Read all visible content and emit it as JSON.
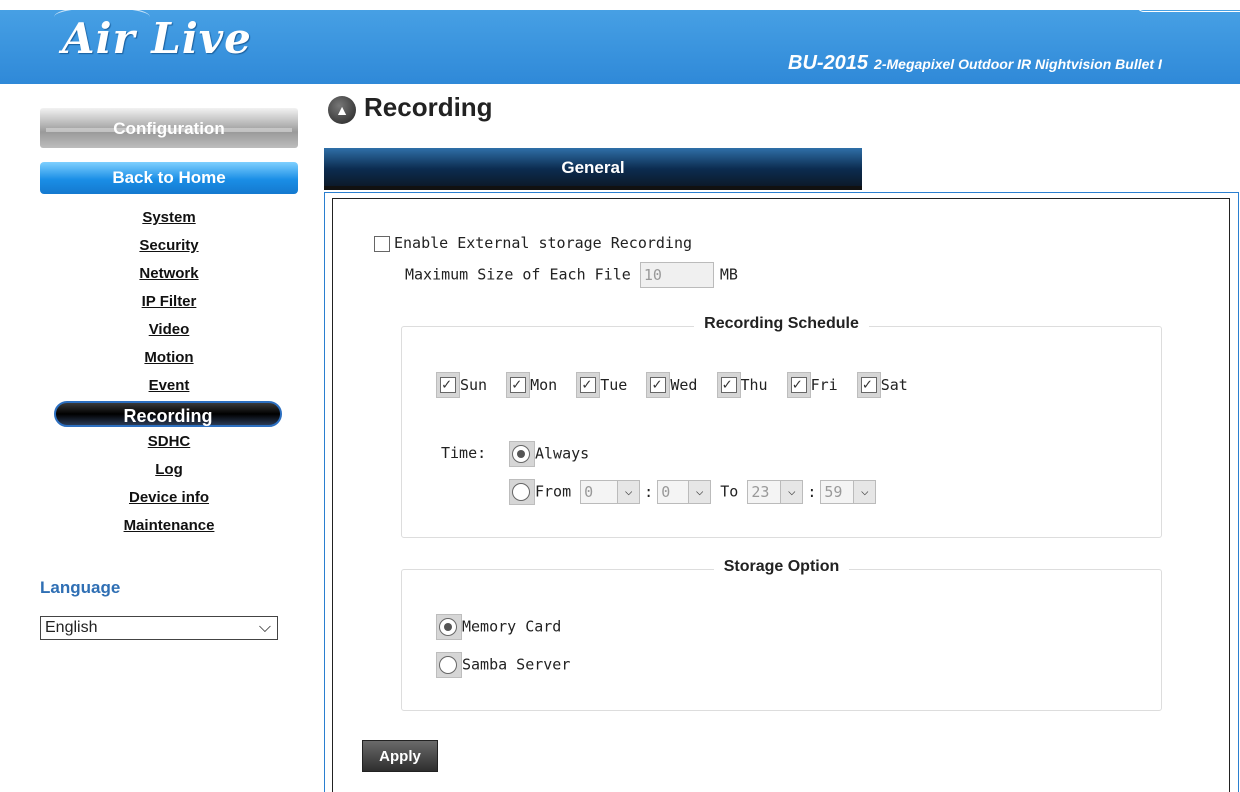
{
  "header": {
    "logo": "Air Live",
    "model": "BU-2015",
    "model_desc": "2-Megapixel Outdoor IR Nightvision Bullet I"
  },
  "sidebar": {
    "config_label": "Configuration",
    "home_label": "Back to Home",
    "items": [
      {
        "label": "System"
      },
      {
        "label": "Security"
      },
      {
        "label": "Network"
      },
      {
        "label": "IP Filter"
      },
      {
        "label": "Video"
      },
      {
        "label": "Motion"
      },
      {
        "label": "Event"
      },
      {
        "label": "Recording",
        "active": true
      },
      {
        "label": "SDHC"
      },
      {
        "label": "Log"
      },
      {
        "label": "Device info"
      },
      {
        "label": "Maintenance"
      }
    ],
    "language_title": "Language",
    "language_value": "English"
  },
  "main": {
    "title": "Recording",
    "tab": "General",
    "enable_label": "Enable External storage Recording",
    "enable_checked": false,
    "maxsize_label": "Maximum Size of Each File",
    "maxsize_value": "10",
    "maxsize_unit": "MB",
    "schedule": {
      "legend": "Recording Schedule",
      "days": [
        {
          "label": "Sun",
          "checked": true
        },
        {
          "label": "Mon",
          "checked": true
        },
        {
          "label": "Tue",
          "checked": true
        },
        {
          "label": "Wed",
          "checked": true
        },
        {
          "label": "Thu",
          "checked": true
        },
        {
          "label": "Fri",
          "checked": true
        },
        {
          "label": "Sat",
          "checked": true
        }
      ],
      "time_label": "Time:",
      "always_label": "Always",
      "from_label": "From",
      "to_label": "To",
      "from_hour": "0",
      "from_min": "0",
      "to_hour": "23",
      "to_min": "59",
      "colon": ":"
    },
    "storage": {
      "legend": "Storage Option",
      "memory_label": "Memory Card",
      "samba_label": "Samba Server",
      "selected": "memory"
    },
    "apply_label": "Apply"
  }
}
